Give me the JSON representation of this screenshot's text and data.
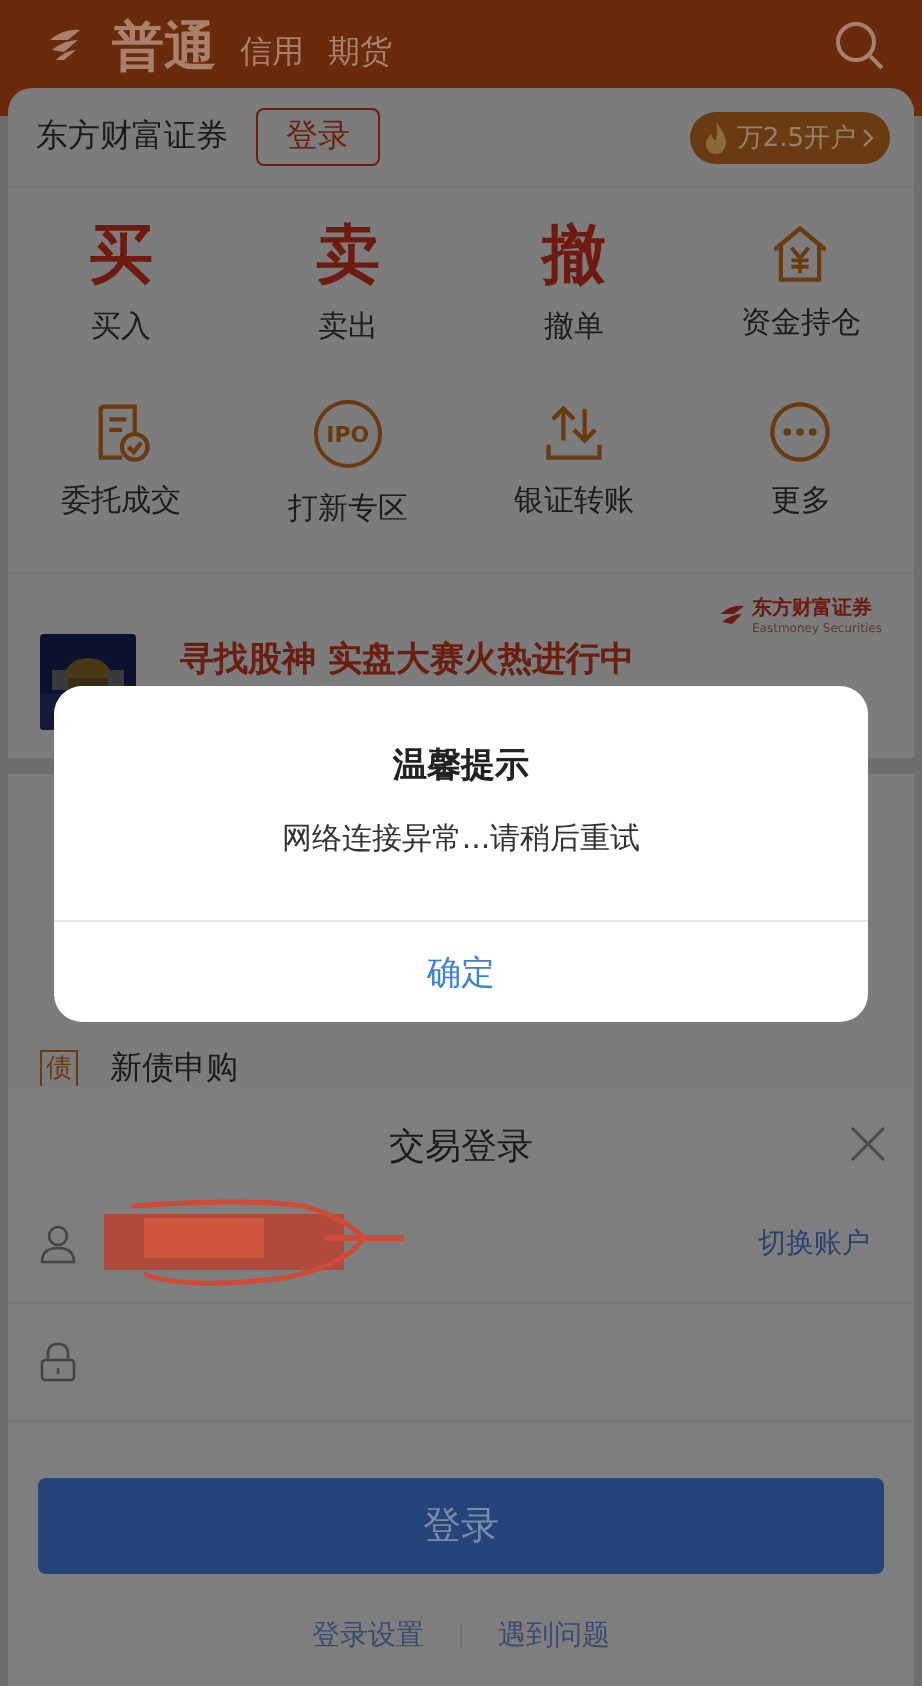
{
  "header": {
    "tabs": [
      {
        "label": "普通",
        "selected": true
      },
      {
        "label": "信用",
        "selected": false
      },
      {
        "label": "期货",
        "selected": false
      }
    ]
  },
  "account_bar": {
    "broker": "东方财富证券",
    "login_button": "登录",
    "promo": "万2.5开户"
  },
  "actions": [
    {
      "kind": "char",
      "glyph": "买",
      "label": "买入"
    },
    {
      "kind": "char",
      "glyph": "卖",
      "label": "卖出"
    },
    {
      "kind": "char",
      "glyph": "撤",
      "label": "撤单"
    },
    {
      "kind": "icon",
      "label": "资金持仓"
    },
    {
      "kind": "icon",
      "label": "委托成交"
    },
    {
      "kind": "badge",
      "glyph": "IPO",
      "label": "打新专区"
    },
    {
      "kind": "icon",
      "label": "银证转账"
    },
    {
      "kind": "icon",
      "label": "更多"
    }
  ],
  "banner": {
    "headline": "寻找股神 实盘大赛火热进行中",
    "brand": "东方财富证券",
    "brand_subtitle": "Eastmoney Securities"
  },
  "menu": [
    {
      "badge": "债",
      "label": "新债申购"
    }
  ],
  "dialog": {
    "title": "温馨提示",
    "message": "网络连接异常...请稍后重试",
    "button": "确定"
  },
  "login_sheet": {
    "title": "交易登录",
    "switch_account": "切换账户",
    "submit": "登录",
    "links": [
      "登录设置",
      "遇到问题"
    ]
  }
}
